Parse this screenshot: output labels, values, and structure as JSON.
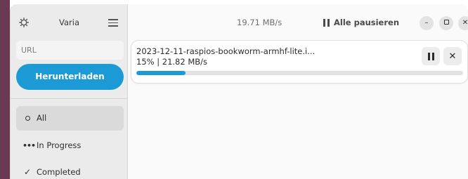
{
  "app": {
    "title": "Varia"
  },
  "sidebar": {
    "url_placeholder": "URL",
    "download_button": "Herunterladen",
    "filters": [
      {
        "label": "All",
        "icon": "radio-dot-icon",
        "active": true
      },
      {
        "label": "In Progress",
        "icon": "ellipsis-icon",
        "active": false
      },
      {
        "label": "Completed",
        "icon": "checkmark-icon",
        "active": false
      }
    ]
  },
  "header": {
    "total_speed": "19.71 MB/s",
    "pause_all_label": "Alle pausieren",
    "window_controls": [
      "minimize-icon",
      "maximize-icon",
      "close-icon"
    ]
  },
  "downloads": [
    {
      "filename": "2023-12-11-raspios-bookworm-armhf-lite.i...",
      "percent": "15%",
      "speed": "21.82 MB/s",
      "separator": "|",
      "progress_fraction": 0.15,
      "actions": [
        "pause-icon",
        "close-icon"
      ]
    }
  ],
  "colors": {
    "accent": "#1c9ad6",
    "sidebar_bg": "#ebebeb",
    "window_bg": "#fafafa"
  }
}
